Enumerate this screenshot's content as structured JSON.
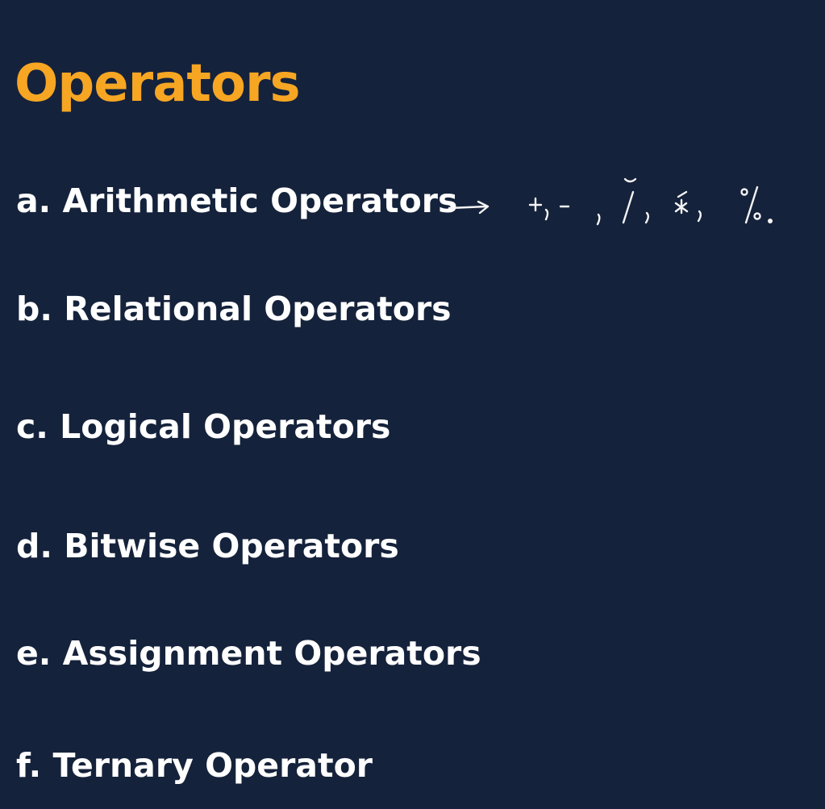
{
  "colors": {
    "background": "#15223b",
    "title": "#f6a623",
    "text": "#ffffff",
    "annotation": "#f4f4f4"
  },
  "title": "Operators",
  "items": [
    {
      "label": "a. Arithmetic Operators"
    },
    {
      "label": "b. Relational Operators"
    },
    {
      "label": "c. Logical Operators"
    },
    {
      "label": "d. Bitwise Operators"
    },
    {
      "label": "e. Assignment Operators"
    },
    {
      "label": "f. Ternary Operator"
    }
  ],
  "annotation": {
    "text": "→ +, - , /, *, %.",
    "style": "handwritten"
  }
}
